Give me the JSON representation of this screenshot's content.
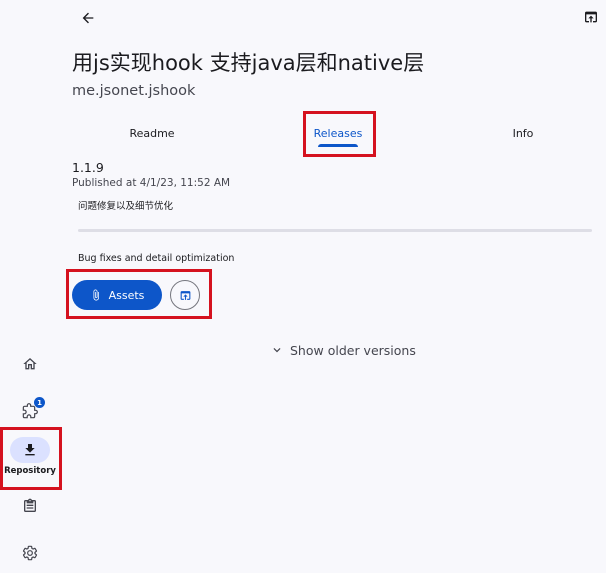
{
  "header": {
    "back_icon": "arrow-back-icon",
    "open_icon": "open-in-browser-icon",
    "title": "用js实现hook 支持java层和native层",
    "package": "me.jsonet.jshook"
  },
  "tabs": [
    {
      "label": "Readme",
      "active": false
    },
    {
      "label": "Releases",
      "active": true
    },
    {
      "label": "Info",
      "active": false
    }
  ],
  "release": {
    "version": "1.1.9",
    "published": "Published at 4/1/23, 11:52 AM",
    "notes_cn": "问题修复以及细节优化",
    "notes_en": "Bug fixes and detail optimization",
    "assets_label": "Assets",
    "assets_icon": "paperclip-icon",
    "open_release_icon": "open-in-browser-icon"
  },
  "older_versions": {
    "label": "Show older versions",
    "icon": "chevron-down-icon"
  },
  "rail": {
    "items": [
      {
        "name": "home",
        "icon": "home-icon",
        "label": ""
      },
      {
        "name": "updates",
        "icon": "puzzle-icon",
        "label": "",
        "badge": "1"
      },
      {
        "name": "repository",
        "icon": "download-icon",
        "label": "Repository",
        "active": true
      },
      {
        "name": "logs",
        "icon": "clipboard-icon",
        "label": ""
      },
      {
        "name": "settings",
        "icon": "gear-icon",
        "label": ""
      }
    ]
  },
  "colors": {
    "accent": "#0d56c9",
    "background": "#f8f8fc",
    "highlight": "#d5121f",
    "rail_active": "#dbe1ff"
  }
}
